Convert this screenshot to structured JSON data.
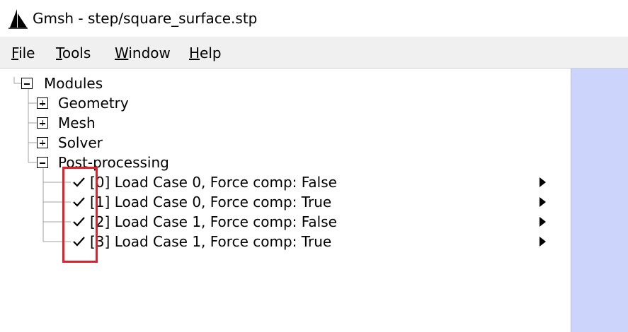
{
  "window": {
    "title": "Gmsh - step/square_surface.stp",
    "app_icon": "gmsh-sail-icon"
  },
  "menubar": {
    "items": [
      {
        "accel": "F",
        "rest": "ile"
      },
      {
        "accel": "T",
        "rest": "ools"
      },
      {
        "accel": "W",
        "rest": "indow"
      },
      {
        "accel": "H",
        "rest": "elp"
      }
    ]
  },
  "tree": {
    "root": {
      "label": "Modules",
      "expanded": true
    },
    "modules": [
      {
        "label": "Geometry",
        "expanded": false
      },
      {
        "label": "Mesh",
        "expanded": false
      },
      {
        "label": "Solver",
        "expanded": false
      },
      {
        "label": "Post-processing",
        "expanded": true
      }
    ],
    "views": [
      {
        "label": "[0] Load Case 0, Force comp: False",
        "checked": true
      },
      {
        "label": "[1] Load Case 0, Force comp: True",
        "checked": true
      },
      {
        "label": "[2] Load Case 1, Force comp: False",
        "checked": true
      },
      {
        "label": "[3] Load Case 1, Force comp: True",
        "checked": true
      }
    ]
  },
  "colors": {
    "highlight": "#e0202a",
    "right_panel": "#cdd4fc",
    "menubar": "#f0f0f0"
  }
}
